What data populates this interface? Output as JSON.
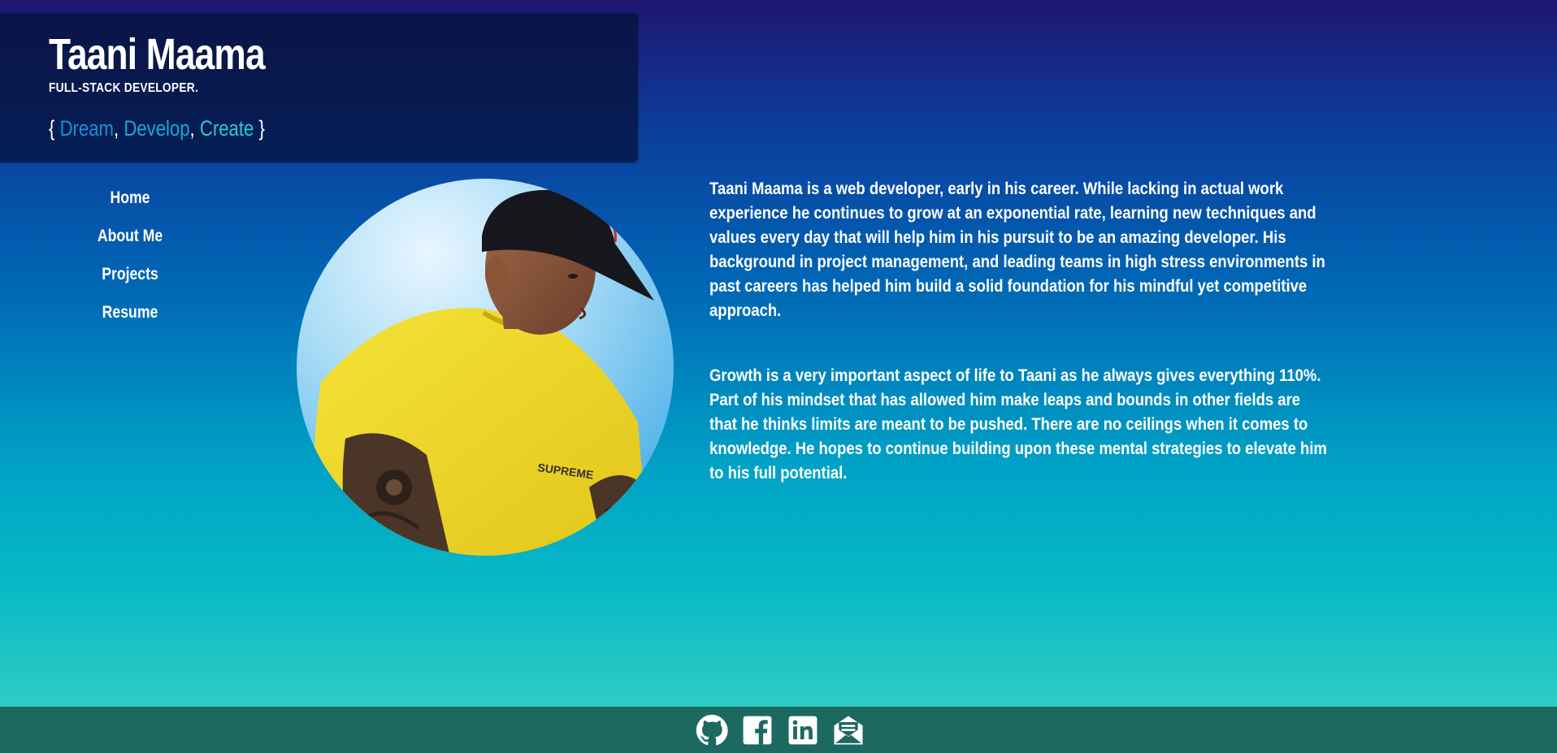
{
  "header": {
    "title": "Taani Maama",
    "subtitle": "FULL-STACK DEVELOPER.",
    "motto": {
      "open_brace": "{",
      "word1": "Dream",
      "sep1": ",",
      "word2": "Develop",
      "sep2": ",",
      "word3": "Create",
      "close_brace": "}"
    },
    "colors": {
      "word1": "#1a8fd6",
      "word2": "#19a8d6",
      "word3": "#2bc9cf"
    }
  },
  "nav": {
    "items": [
      {
        "label": "Home"
      },
      {
        "label": "About Me"
      },
      {
        "label": "Projects"
      },
      {
        "label": "Resume"
      }
    ]
  },
  "about": {
    "paragraphs": [
      "Taani Maama is a web developer, early in his career. While lacking in actual work experience he continues to grow at an exponential rate, learning new techniques and values every day that will help him in his pursuit to be an amazing developer. His background in project management, and leading teams in high stress environments in past careers has helped him build a solid foundation for his mindful yet competitive approach.",
      "Growth is a very important aspect of life to Taani as he always gives everything 110%. Part of his mindset that has allowed him make leaps and bounds in other fields are that he thinks limits are meant to be pushed. There are no ceilings when it comes to knowledge. He hopes to continue building upon these mental strategies to elevate him to his full potential."
    ]
  },
  "footer": {
    "icons": [
      "github-icon",
      "facebook-icon",
      "linkedin-icon",
      "email-icon"
    ],
    "background": "#1c6962"
  }
}
